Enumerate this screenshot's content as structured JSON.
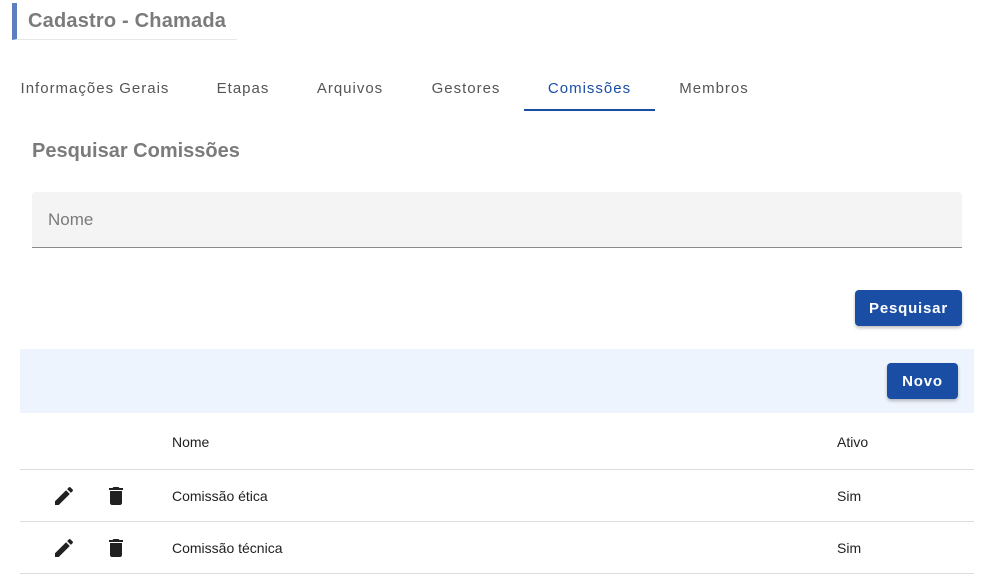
{
  "header": {
    "title": "Cadastro - Chamada"
  },
  "tabs": [
    {
      "label": "Informações Gerais"
    },
    {
      "label": "Etapas"
    },
    {
      "label": "Arquivos"
    },
    {
      "label": "Gestores"
    },
    {
      "label": "Comissões"
    },
    {
      "label": "Membros"
    }
  ],
  "active_tab": "Comissões",
  "search": {
    "title": "Pesquisar Comissões",
    "name_placeholder": "Nome",
    "name_value": "",
    "button_label": "Pesquisar"
  },
  "toolbar": {
    "new_label": "Novo"
  },
  "table": {
    "columns": {
      "name": "Nome",
      "active": "Ativo"
    },
    "rows": [
      {
        "name": "Comissão ética",
        "active": "Sim"
      },
      {
        "name": "Comissão técnica",
        "active": "Sim"
      }
    ]
  },
  "icons": {
    "edit": "pencil-icon",
    "delete": "trash-icon"
  },
  "colors": {
    "accent": "#1a4ea5",
    "header_bar": "#5b7fbf",
    "toolbar_bg": "#eef4fd",
    "field_bg": "#f4f4f4"
  }
}
